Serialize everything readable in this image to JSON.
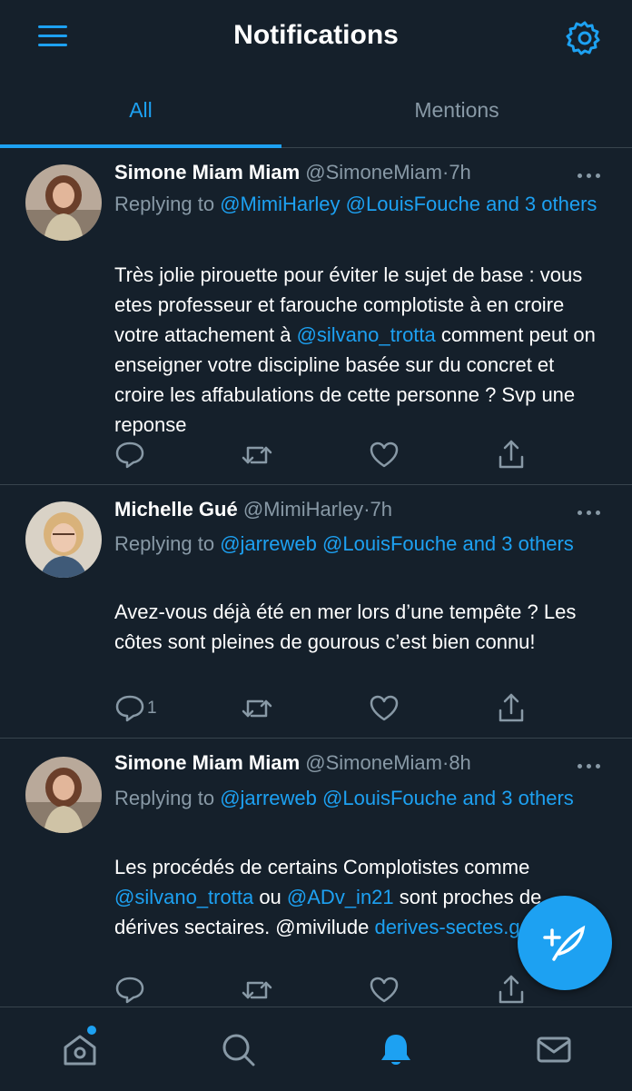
{
  "header": {
    "title": "Notifications",
    "menu_icon": "menu-icon",
    "settings_icon": "gear-icon"
  },
  "tabs": [
    {
      "label": "All",
      "selected": true
    },
    {
      "label": "Mentions",
      "selected": false
    }
  ],
  "colors": {
    "background": "#15202b",
    "accent": "#1da1f2",
    "muted": "#8899a6",
    "divider": "#38444d"
  },
  "tweets": [
    {
      "name": "Simone Miam Miam",
      "handle": "@SimoneMiam",
      "dot": "·",
      "time": "7h",
      "replying_prefix": "Replying to",
      "replying_users": "@MimiHarley @LouisFouche",
      "replying_suffix": "and 3 others",
      "text_parts": [
        "Très jolie pirouette pour éviter le sujet de base : vous etes professeur et farouche complotiste à en croire votre attachement à",
        "@silvano_trotta",
        "comment peut on enseigner votre discipline basée sur du concret et croire les affabulations de cette personne ? Svp une reponse"
      ],
      "reply_count": ""
    },
    {
      "name": "Michelle Gué",
      "handle": "@MimiHarley",
      "dot": "·",
      "time": "7h",
      "replying_prefix": "Replying to",
      "replying_users": "@jarreweb @LouisFouche",
      "replying_suffix": "and 3 others",
      "text_parts": [
        "Avez-vous déjà été en mer lors d’une tempête ? Les côtes sont pleines de gourous c’est bien connu!"
      ],
      "reply_count": "1"
    },
    {
      "name": "Simone Miam Miam",
      "handle": "@SimoneMiam",
      "dot": "·",
      "time": "8h",
      "replying_prefix": "Replying to",
      "replying_users": "@jarreweb @LouisFouche",
      "replying_suffix": "and 3 others",
      "text_parts": [
        "Les procédés de certains Complotistes comme",
        "@silvano_trotta",
        "ou",
        "@ADv_in21",
        "sont proches de dérives sectaires. @mivilude",
        "derives-sectes.gouv.fr"
      ],
      "reply_count": ""
    }
  ],
  "actions": [
    "reply-icon",
    "retweet-icon",
    "like-icon",
    "share-icon"
  ],
  "compose_icon": "compose-tweet-icon",
  "bottom_nav": [
    "home-icon",
    "search-icon",
    "bell-icon",
    "mail-icon"
  ]
}
